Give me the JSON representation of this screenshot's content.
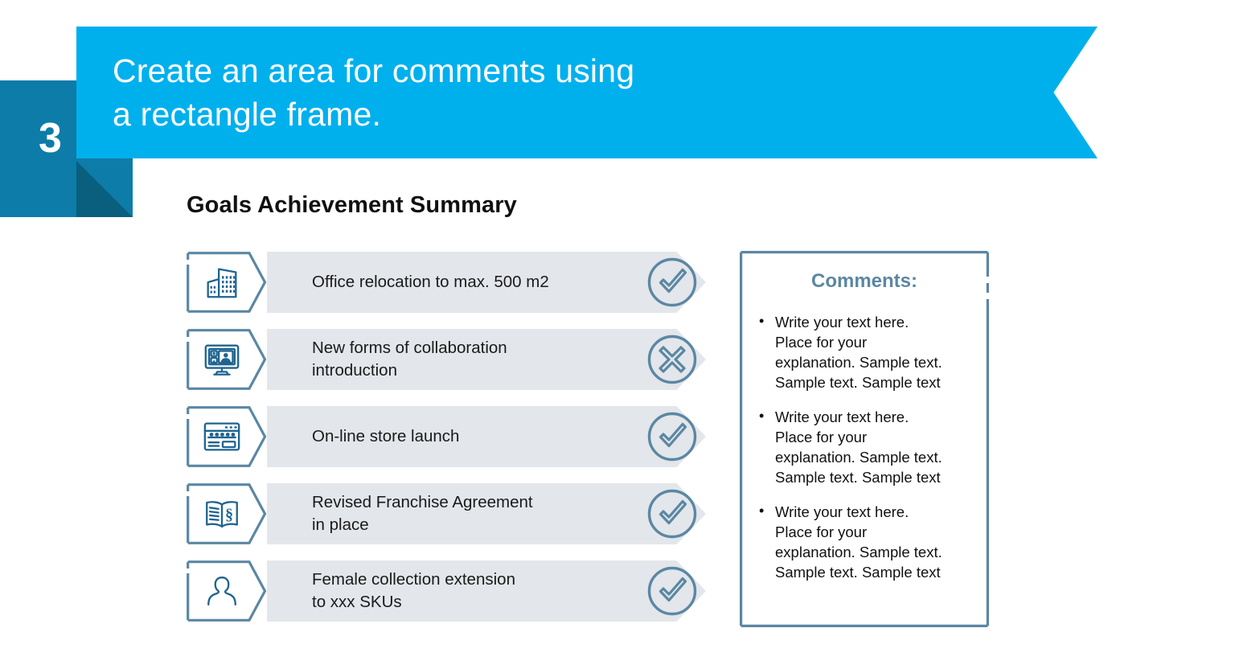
{
  "theme": {
    "banner_color": "#00B0ED",
    "badge_color": "#0D7CA9",
    "badge_fold_color": "#0A5E7E",
    "accent_steel": "#5B87A3",
    "icon_blue": "#1F6491",
    "bar_gray": "#E3E6EA",
    "text_dark": "#111111"
  },
  "header": {
    "step_number": "3",
    "title": "Create an area for comments using\na rectangle frame."
  },
  "main": {
    "section_title": "Goals Achievement Summary",
    "goals": [
      {
        "icon": "office-building-icon",
        "label": "Office relocation to max. 500 m2",
        "status": "check",
        "status_name": "status-achieved-icon"
      },
      {
        "icon": "video-conference-monitor-icon",
        "label": "New forms of collaboration\nintroduction",
        "status": "cross",
        "status_name": "status-not-achieved-icon"
      },
      {
        "icon": "online-store-browser-icon",
        "label": "On-line store launch",
        "status": "check",
        "status_name": "status-achieved-icon"
      },
      {
        "icon": "law-book-icon",
        "label": "Revised Franchise Agreement\nin place",
        "status": "check",
        "status_name": "status-achieved-icon"
      },
      {
        "icon": "person-silhouette-icon",
        "label": "Female collection extension\nto xxx SKUs",
        "status": "check",
        "status_name": "status-achieved-icon"
      }
    ]
  },
  "comments": {
    "heading": "Comments:",
    "bullet_glyph": "•",
    "items": [
      "Write your text here.\nPlace for your\nexplanation. Sample text.\nSample text. Sample text",
      "Write your text here.\nPlace for your\nexplanation. Sample text.\nSample text. Sample text",
      "Write your text here.\nPlace for your\nexplanation. Sample text.\nSample text. Sample text"
    ]
  }
}
